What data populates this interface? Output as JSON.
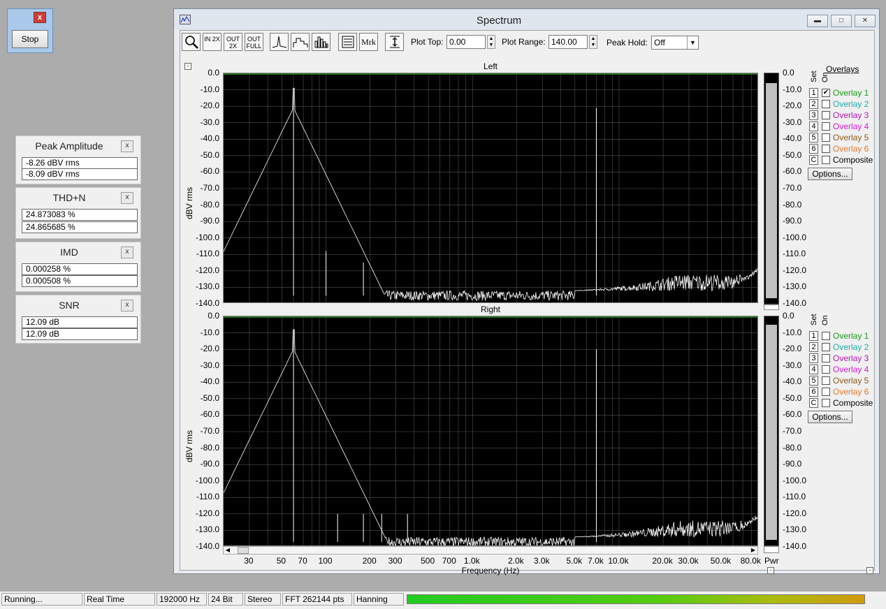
{
  "stop_widget": {
    "close": "x",
    "label": "Stop"
  },
  "meters": [
    {
      "title": "Peak Amplitude",
      "close": "x",
      "values": [
        "-8.26 dBV rms",
        "-8.09 dBV rms"
      ]
    },
    {
      "title": "THD+N",
      "close": "x",
      "values": [
        "24.873083 %",
        "24.865685 %"
      ]
    },
    {
      "title": "IMD",
      "close": "x",
      "values": [
        "0.000258 %",
        "0.000508 %"
      ]
    },
    {
      "title": "SNR",
      "close": "x",
      "values": [
        "12.09 dB",
        "12.09 dB"
      ]
    }
  ],
  "window": {
    "title": "Spectrum",
    "toolbar": {
      "zoom_in_label": "IN 2X",
      "zoom_out_label": "OUT 2X",
      "zoom_full_label": "OUT FULL",
      "marker_label": "Mrk",
      "plot_top_label": "Plot Top:",
      "plot_top_value": "0.00",
      "plot_range_label": "Plot Range:",
      "plot_range_value": "140.00",
      "peak_hold_label": "Peak Hold:",
      "peak_hold_value": "Off"
    },
    "collapse_symbol": "-"
  },
  "overlays": {
    "header": "Overlays",
    "set_label": "Set",
    "on_label": "On",
    "items": [
      {
        "set": "1",
        "name": "Overlay 1",
        "color": "#1a9a1a",
        "checked": true
      },
      {
        "set": "2",
        "name": "Overlay 2",
        "color": "#22aaaa",
        "checked": false
      },
      {
        "set": "3",
        "name": "Overlay 3",
        "color": "#b01ab0",
        "checked": false
      },
      {
        "set": "4",
        "name": "Overlay 4",
        "color": "#d21ad2",
        "checked": false
      },
      {
        "set": "5",
        "name": "Overlay 5",
        "color": "#8a5a1a",
        "checked": false
      },
      {
        "set": "6",
        "name": "Overlay 6",
        "color": "#e07a30",
        "checked": false
      },
      {
        "set": "C",
        "name": "Composite",
        "color": "#000000",
        "checked": false
      }
    ],
    "options_label": "Options..."
  },
  "right_overlay_checks": [
    false,
    false,
    false,
    false,
    false,
    false,
    false
  ],
  "level_meter_label": "Pwr",
  "status": {
    "state": "Running...",
    "mode": "Real Time",
    "rate": "192000 Hz",
    "bits": "24 Bit",
    "channels": "Stereo",
    "fft": "FFT 262144 pts",
    "window_fn": "Hanning"
  },
  "chart_data": [
    {
      "type": "line",
      "title": "Left",
      "ylabel": "dBV rms",
      "xlabel": "",
      "x_scale": "log",
      "xlim": [
        20,
        90000
      ],
      "ylim": [
        -140,
        0
      ],
      "yticks": [
        "0.0",
        "-10.0",
        "-20.0",
        "-30.0",
        "-40.0",
        "-50.0",
        "-60.0",
        "-70.0",
        "-80.0",
        "-90.0",
        "-100.0",
        "-110.0",
        "-120.0",
        "-130.0",
        "-140.0"
      ],
      "grid": true,
      "series": [
        {
          "color": "#ffffff",
          "peaks": [
            {
              "x": 60,
              "y": -9
            },
            {
              "x": 100,
              "y": -108
            },
            {
              "x": 180,
              "y": -115
            },
            {
              "x": 7000,
              "y": -21
            }
          ],
          "noise_floor": -135
        }
      ],
      "level_meter_db": -6
    },
    {
      "type": "line",
      "title": "Right",
      "ylabel": "dBV rms",
      "xlabel": "Frequency (Hz)",
      "x_scale": "log",
      "xlim": [
        20,
        90000
      ],
      "xticks": [
        "30",
        "50",
        "70",
        "100",
        "200",
        "300",
        "500",
        "700",
        "1.0k",
        "2.0k",
        "3.0k",
        "5.0k",
        "7.0k",
        "10.0k",
        "20.0k",
        "30.0k",
        "50.0k",
        "80.0k"
      ],
      "ylim": [
        -140,
        0
      ],
      "yticks": [
        "0.0",
        "-10.0",
        "-20.0",
        "-30.0",
        "-40.0",
        "-50.0",
        "-60.0",
        "-70.0",
        "-80.0",
        "-90.0",
        "-100.0",
        "-110.0",
        "-120.0",
        "-130.0",
        "-140.0"
      ],
      "grid": true,
      "series": [
        {
          "color": "#ffffff",
          "peaks": [
            {
              "x": 60,
              "y": -8
            },
            {
              "x": 120,
              "y": -120
            },
            {
              "x": 180,
              "y": -120
            },
            {
              "x": 240,
              "y": -120
            },
            {
              "x": 360,
              "y": -120
            },
            {
              "x": 7000,
              "y": -20
            }
          ],
          "noise_floor": -137
        }
      ],
      "level_meter_db": -6
    }
  ]
}
